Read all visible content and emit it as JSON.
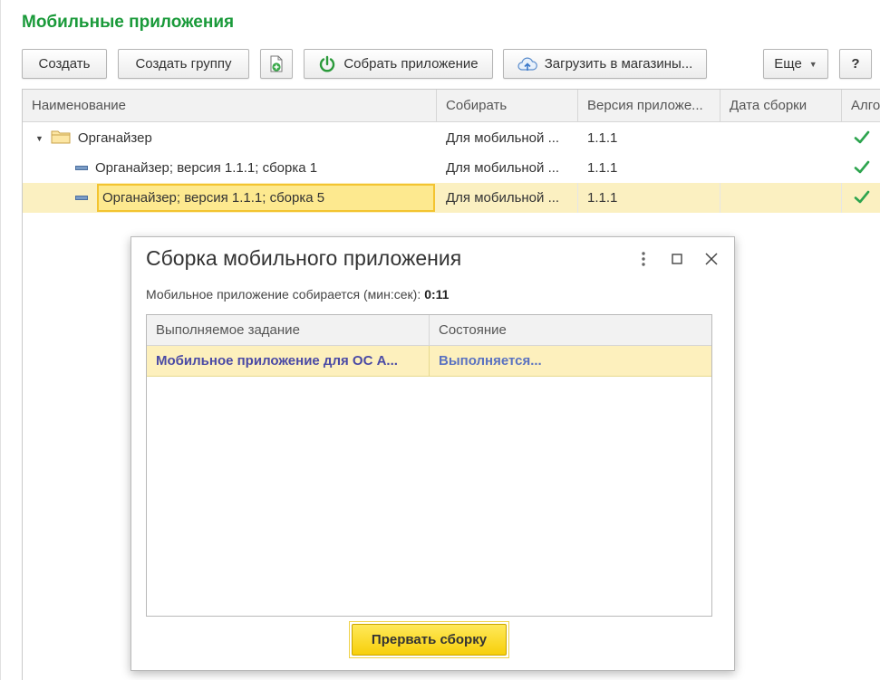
{
  "page": {
    "title": "Мобильные приложения"
  },
  "toolbar": {
    "create": "Создать",
    "create_group": "Создать группу",
    "copy_icon": "copy-add-icon",
    "build": "Собрать приложение",
    "upload": "Загрузить в магазины...",
    "more": "Еще",
    "help": "?"
  },
  "grid": {
    "columns": [
      "Наименование",
      "Собирать",
      "Версия приложе...",
      "Дата сборки",
      "Алго"
    ],
    "rows": [
      {
        "name": "Органайзер",
        "type": "group",
        "build_for": "Для мобильной ...",
        "version": "1.1.1",
        "date": "",
        "check": true
      },
      {
        "name": "Органайзер; версия 1.1.1; сборка 1",
        "type": "item",
        "build_for": "Для мобильной ...",
        "version": "1.1.1",
        "date": "",
        "check": true
      },
      {
        "name": "Органайзер; версия 1.1.1; сборка 5",
        "type": "item",
        "build_for": "Для мобильной ...",
        "version": "1.1.1",
        "date": "",
        "check": true,
        "selected": true
      }
    ]
  },
  "dialog": {
    "title": "Сборка мобильного приложения",
    "status_label": "Мобильное приложение собирается (мин:сек):",
    "status_time": "0:11",
    "table": {
      "columns": [
        "Выполняемое задание",
        "Состояние"
      ],
      "rows": [
        {
          "task": "Мобильное приложение для ОС А...",
          "state": "Выполняется..."
        }
      ]
    },
    "abort_button": "Прервать сборку"
  },
  "colors": {
    "title_green": "#1a9a3a",
    "selection": "#fbf0c1",
    "focus_border": "#f3c431",
    "check_green": "#2da44e",
    "abort_yellow": "#f7cf0a",
    "task_text": "#4a4aa5"
  }
}
